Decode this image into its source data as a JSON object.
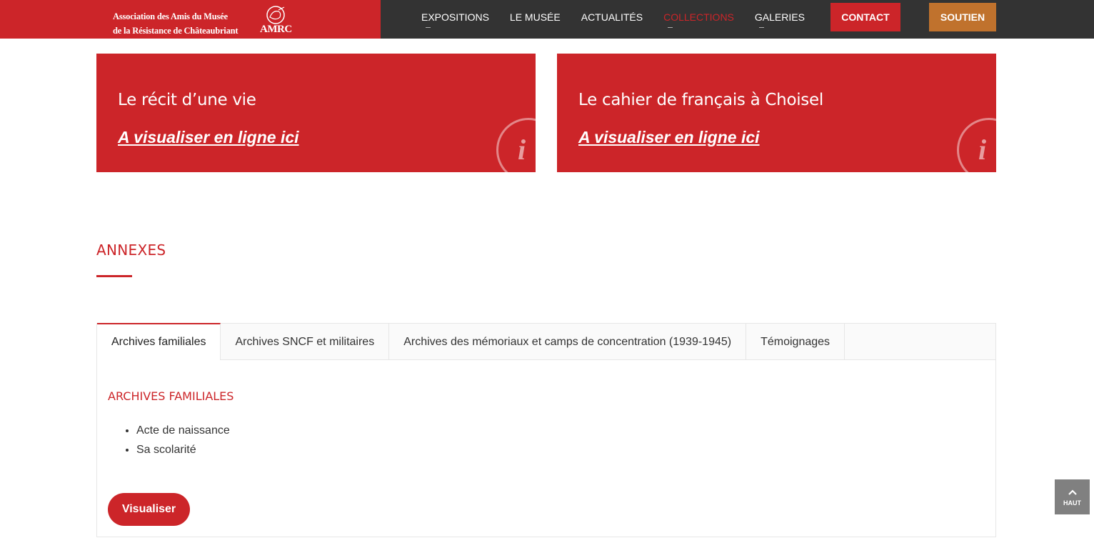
{
  "header": {
    "logo_line1": "Association des Amis du Musée",
    "logo_line2": "de la Résistance de Châteaubriant",
    "logo_mark": "AMRC",
    "nav": [
      {
        "label": "EXPOSITIONS"
      },
      {
        "label": "LE MUSÉE"
      },
      {
        "label": "ACTUALITÉS"
      },
      {
        "label": "COLLECTIONS"
      },
      {
        "label": "GALERIES"
      }
    ],
    "contact_label": "CONTACT",
    "soutien_label": "SOUTIEN"
  },
  "cards": [
    {
      "title": "Le récit d’une vie",
      "link": "A visualiser en ligne ici",
      "icon": "info-icon"
    },
    {
      "title": "Le cahier de français à Choisel",
      "link": "A visualiser en ligne ici",
      "icon": "info-icon"
    }
  ],
  "annexes": {
    "title": "ANNEXES",
    "tabs": [
      {
        "label": "Archives familiales"
      },
      {
        "label": "Archives SNCF et militaires"
      },
      {
        "label": "Archives des mémoriaux et camps de concentration (1939-1945)"
      },
      {
        "label": "Témoignages"
      }
    ],
    "active_tab": {
      "heading": "ARCHIVES FAMILIALES",
      "items": [
        "Acte de naissance",
        "Sa scolarité"
      ],
      "button_label": "Visualiser"
    }
  },
  "back_to_top": {
    "label": "HAUT",
    "icon": "chevron-up-icon"
  },
  "colors": {
    "brand_red": "#cc2529",
    "header_dark": "#333333",
    "soutien_orange": "#c0722d"
  }
}
